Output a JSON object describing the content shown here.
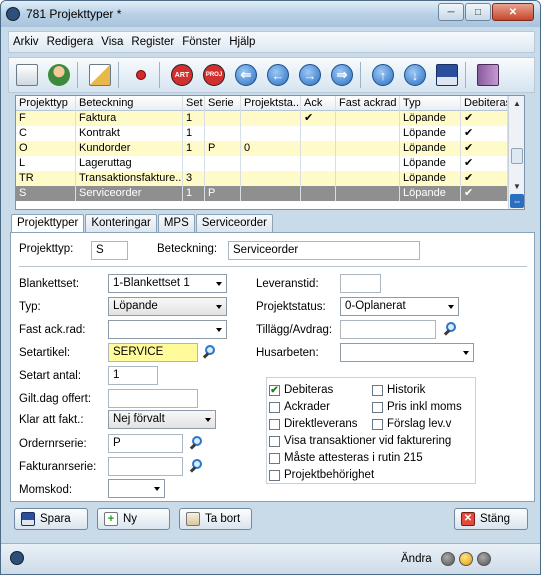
{
  "window": {
    "title": "781 Projekttyper *",
    "min_label": "─",
    "max_label": "□",
    "close_label": "✕"
  },
  "menu": [
    "Arkiv",
    "Redigera",
    "Visa",
    "Register",
    "Fönster",
    "Hjälp"
  ],
  "toolbar": {
    "icons": [
      "copy-icon",
      "add-user-icon",
      "edit-icon",
      "pin-icon",
      "art-icon",
      "proj-icon",
      "back-arrow-icon",
      "prev-arrow-icon",
      "next-arrow-icon",
      "forward-arrow-icon",
      "up-arrow-icon",
      "down-arrow-icon",
      "save-icon",
      "book-icon"
    ],
    "art_label": "ART",
    "proj_label": "PROJ"
  },
  "grid": {
    "columns": [
      "Projekttyp",
      "Beteckning",
      "Set",
      "Serie",
      "Projektsta...",
      "Ack",
      "Fast ackrad",
      "Typ",
      "Debiteras"
    ],
    "rows": [
      {
        "c": [
          "F",
          "Faktura",
          "1",
          "",
          "",
          "✔",
          "",
          "Löpande",
          "✔"
        ],
        "style": "y"
      },
      {
        "c": [
          "C",
          "Kontrakt",
          "1",
          "",
          "",
          "",
          "",
          "Löpande",
          "✔"
        ],
        "style": "w"
      },
      {
        "c": [
          "O",
          "Kundorder",
          "1",
          "P",
          "0",
          "",
          "",
          "Löpande",
          "✔"
        ],
        "style": "y"
      },
      {
        "c": [
          "L",
          "Lageruttag",
          "",
          "",
          "",
          "",
          "",
          "Löpande",
          "✔"
        ],
        "style": "w"
      },
      {
        "c": [
          "TR",
          "Transaktionsfakture...",
          "3",
          "",
          "",
          "",
          "",
          "Löpande",
          "✔"
        ],
        "style": "y"
      },
      {
        "c": [
          "S",
          "Serviceorder",
          "1",
          "P",
          "",
          "",
          "",
          "Löpande",
          "✔"
        ],
        "style": "sel"
      }
    ]
  },
  "tabs": [
    "Projekttyper",
    "Konteringar",
    "MPS",
    "Serviceorder"
  ],
  "form": {
    "projekttyp_label": "Projekttyp:",
    "projekttyp_value": "S",
    "beteckning_label": "Beteckning:",
    "beteckning_value": "Serviceorder",
    "blankettset_label": "Blankettset:",
    "blankettset_value": "1-Blankettset 1",
    "typ_label": "Typ:",
    "typ_value": "Löpande",
    "fastack_label": "Fast ack.rad:",
    "fastack_value": "",
    "setartikel_label": "Setartikel:",
    "setartikel_value": "SERVICE",
    "setartal_label": "Setart antal:",
    "setartal_value": "1",
    "giltdag_label": "Gilt.dag offert:",
    "giltdag_value": "",
    "klar_label": "Klar att fakt.:",
    "klar_value": "Nej förvalt",
    "ordernr_label": "Ordernrserie:",
    "ordernr_value": "P",
    "faktura_label": "Fakturanrserie:",
    "faktura_value": "",
    "moms_label": "Momskod:",
    "moms_value": "",
    "leveranstid_label": "Leveranstid:",
    "leveranstid_value": "",
    "projektstatus_label": "Projektstatus:",
    "projektstatus_value": "0-Oplanerat",
    "tillagg_label": "Tillägg/Avdrag:",
    "tillagg_value": "",
    "husarbeten_label": "Husarbeten:",
    "husarbeten_value": ""
  },
  "checkboxes": [
    {
      "label": "Debiteras",
      "checked": true
    },
    {
      "label": "Historik",
      "checked": false
    },
    {
      "label": "Ackrader",
      "checked": false
    },
    {
      "label": "Pris inkl moms",
      "checked": false
    },
    {
      "label": "Direktleverans",
      "checked": false
    },
    {
      "label": "Förslag lev.v",
      "checked": false
    },
    {
      "label": "Visa transaktioner vid fakturering",
      "checked": false
    },
    {
      "label": "Måste attesteras i rutin 215",
      "checked": false
    },
    {
      "label": "Projektbehörighet",
      "checked": false
    }
  ],
  "buttons": {
    "save": "Spara",
    "new": "Ny",
    "delete": "Ta bort",
    "close": "Stäng"
  },
  "status": {
    "text": "Ändra"
  }
}
